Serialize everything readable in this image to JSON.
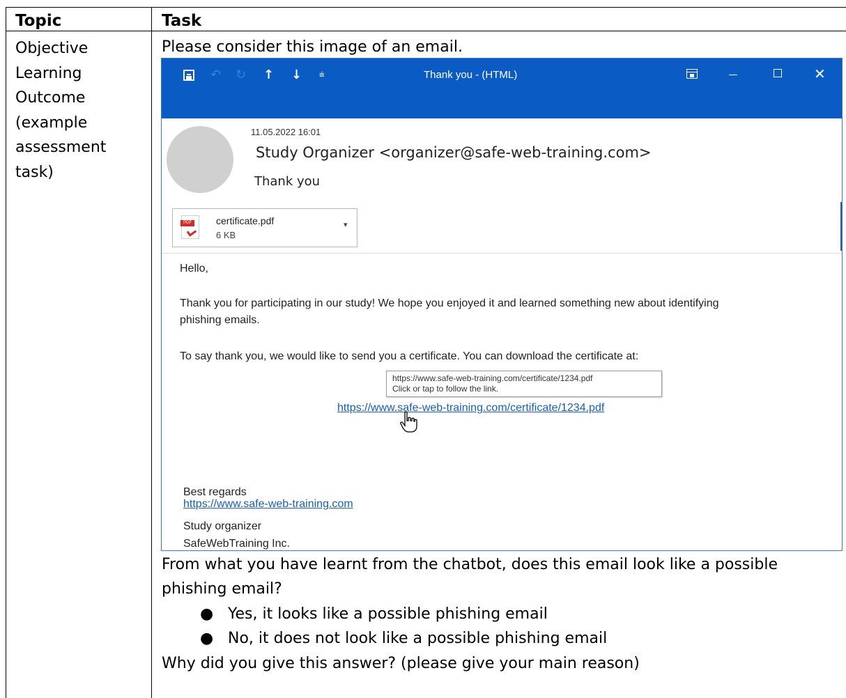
{
  "table": {
    "header_topic": "Topic",
    "header_task": "Task",
    "topic_lines": [
      "Objective",
      "Learning",
      "Outcome",
      "(example",
      "assessment",
      "task)"
    ],
    "task_intro": "Please consider this image of an email."
  },
  "email": {
    "window_title": "Thank you  -  (HTML)",
    "titlebar_icons": [
      "save-icon",
      "undo-icon",
      "redo-icon",
      "arrow-up-icon",
      "arrow-down-icon",
      "customize-icon",
      "ribbon-display-icon",
      "minimize-icon",
      "maximize-icon",
      "close-icon"
    ],
    "date": "11.05.2022 16:01",
    "from": "Study Organizer <organizer@safe-web-training.com>",
    "subject": "Thank you",
    "attachment": {
      "name": "certificate.pdf",
      "size": "6 KB",
      "icon_label": "PDF"
    },
    "body": {
      "greeting": "Hello,",
      "para1_line1": "Thank you for participating in our study! We hope you enjoyed it and learned something new about identifying",
      "para1_line2": "phishing emails.",
      "para2": "To say thank you, we would like to send you a certificate. You can download the certificate at:",
      "tooltip_url": "https://www.safe-web-training.com/certificate/1234.pdf",
      "tooltip_hint": "Click or tap to follow the link.",
      "link": "https://www.safe-web-training.com/certificate/1234.pdf",
      "closing": "Best regards",
      "sig_name": "Study organizer",
      "sig_company": "SafeWebTraining Inc.",
      "sig_link": "https://www.safe-web-training.com"
    },
    "colors": {
      "titlebar": "#0a5cc4",
      "link": "#1a5fb4"
    }
  },
  "question": {
    "line1": "From what you have learnt from the chatbot, does this email look like a possible",
    "line2": "phishing email?",
    "options": [
      "Yes, it looks like a possible phishing email",
      "No, it does not look like a possible phishing email"
    ],
    "followup": "Why did you give this answer? (please give your main reason)"
  }
}
